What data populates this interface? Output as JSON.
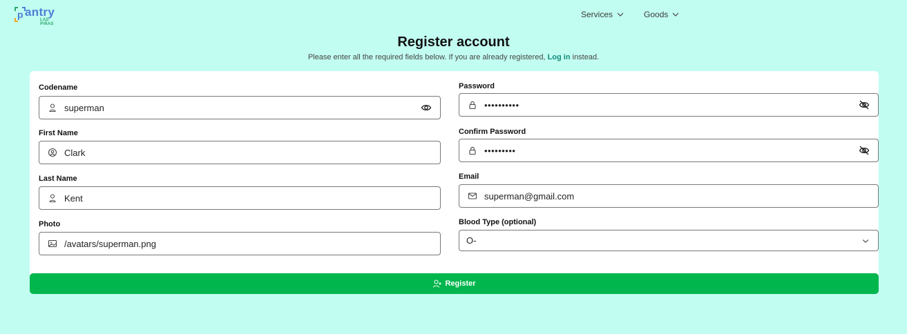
{
  "brand": {
    "name": "antry",
    "bracket_letter": "p",
    "sub": "LAS PIÑAS"
  },
  "nav": [
    {
      "label": "Services",
      "icon": "chevron-down-icon"
    },
    {
      "label": "Goods",
      "icon": "chevron-down-icon"
    }
  ],
  "page": {
    "title": "Register account",
    "subtitle_pre": "Please enter all the required fields below. If you are already registered,",
    "login_link": "Log in",
    "subtitle_post": "instead."
  },
  "form": {
    "codename": {
      "label": "Codename",
      "value": "superman",
      "icon": "user-icon",
      "trail_icon": "eye-icon"
    },
    "first_name": {
      "label": "First Name",
      "value": "Clark",
      "icon": "user-circle-icon"
    },
    "last_name": {
      "label": "Last Name",
      "value": "Kent",
      "icon": "user-icon"
    },
    "photo": {
      "label": "Photo",
      "value": "/avatars/superman.png",
      "icon": "image-icon"
    },
    "password": {
      "label": "Password",
      "value": "••••••••••",
      "icon": "lock-icon",
      "trail_icon": "eye-off-icon"
    },
    "confirm_password": {
      "label": "Confirm Password",
      "value": "•••••••••",
      "icon": "lock-icon",
      "trail_icon": "eye-off-icon"
    },
    "email": {
      "label": "Email",
      "value": "superman@gmail.com",
      "icon": "mail-icon"
    },
    "blood_type": {
      "label": "Blood Type (optional)",
      "value": "O-",
      "icon": "chevron-down-icon"
    }
  },
  "register_button": {
    "label": "Register",
    "icon": "user-plus-icon"
  },
  "colors": {
    "background": "#c2fdf1",
    "accent": "#00b64d",
    "link": "#0f8a7a"
  }
}
